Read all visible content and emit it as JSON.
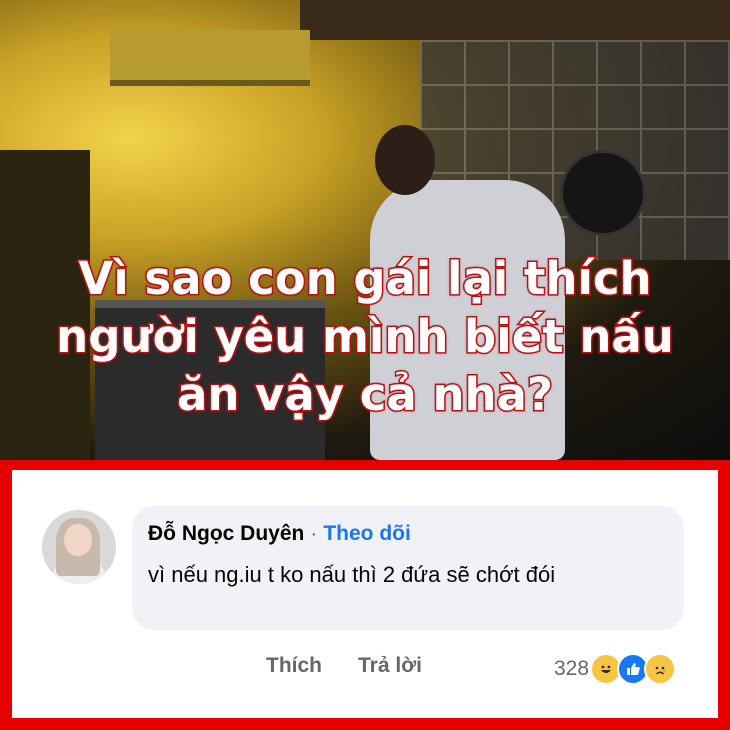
{
  "headline": {
    "lines": [
      "Vì sao con gái lại thích",
      "người yêu mình biết nấu",
      "ăn vậy cả nhà?"
    ]
  },
  "comment": {
    "author": "Đỗ Ngọc Duyên",
    "separator": "·",
    "follow_label": "Theo dõi",
    "text": "vì nếu ng.iu t ko nấu thì 2 đứa sẽ chớt đói",
    "like_label": "Thích",
    "reply_label": "Trả lời",
    "reaction_count": "328",
    "reactions": [
      "haha-icon",
      "like-icon",
      "sad-icon"
    ]
  },
  "colors": {
    "frame": "#e60000",
    "headline_stroke": "#b51414",
    "follow": "#1877f2",
    "bubble": "#f0f2f5"
  }
}
